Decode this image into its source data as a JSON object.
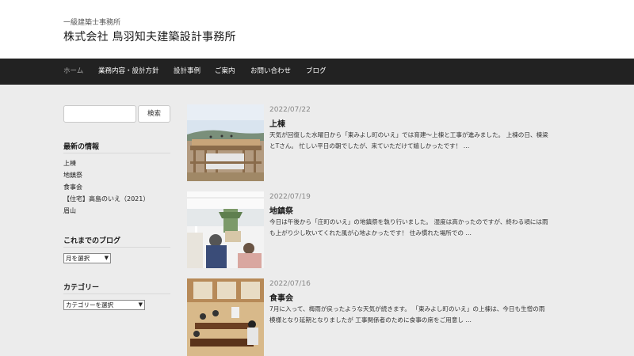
{
  "header": {
    "subtitle": "一級建築士事務所",
    "title": "株式会社 鳥羽知夫建築設計事務所"
  },
  "nav": {
    "items": [
      {
        "label": "ホーム",
        "current": true
      },
      {
        "label": "業務内容・設計方針"
      },
      {
        "label": "設計事例"
      },
      {
        "label": "ご案内"
      },
      {
        "label": "お問い合わせ"
      },
      {
        "label": "ブログ"
      }
    ]
  },
  "sidebar": {
    "search": {
      "placeholder": "",
      "button_label": "検索"
    },
    "recent": {
      "title": "最新の情報",
      "items": [
        "上棟",
        "地鎮祭",
        "食事会",
        "【住宅】高島のいえ（2021）",
        "眉山"
      ]
    },
    "archive": {
      "title": "これまでのブログ",
      "select_value": "月を選択"
    },
    "categories": {
      "title": "カテゴリー",
      "select_value": "カテゴリーを選択"
    }
  },
  "posts": [
    {
      "date": "2022/07/22",
      "title": "上棟",
      "excerpt": "天気が回復した水曜日から「東みよし町のいえ」では育建〜上棟と工事が進みました。 上棟の日、棟梁とTさん。 忙しい平日の朝でしたが、来ていただけて嬉しかったです！ …"
    },
    {
      "date": "2022/07/19",
      "title": "地鎮祭",
      "excerpt": "今日は午後から「庄町のいえ」の地鎮祭を執り行いました。 湿度は高かったのですが、終わる頃には雨も上がり少し吹いてくれた風が心地よかったです！ 住み慣れた場所での …"
    },
    {
      "date": "2022/07/16",
      "title": "食事会",
      "excerpt": "7月に入って、梅雨が戻ったような天気が続きます。 「東みよし町のいえ」の上棟は、今日も生憎の雨模様となり延期となりましたが 工事関係者のために食事の席をご用意し …"
    }
  ],
  "colors": {
    "nav_bg": "#222222",
    "page_bg": "#ececec",
    "header_bg": "#ffffff"
  }
}
